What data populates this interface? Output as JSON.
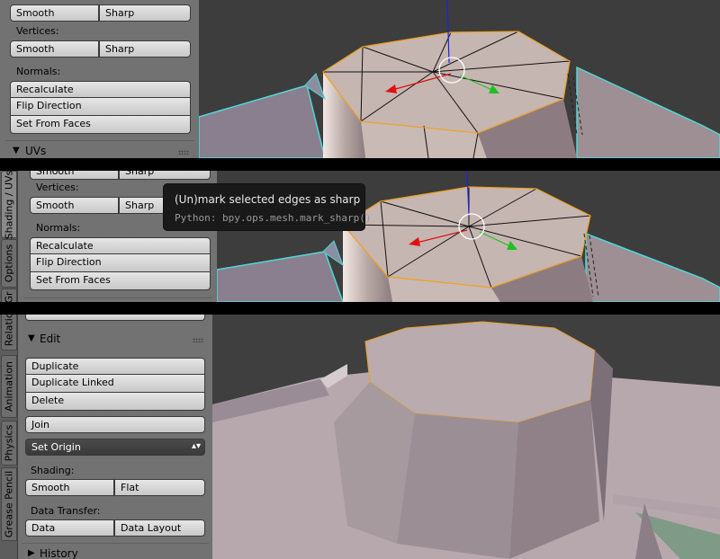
{
  "panel1": {
    "top_row": [
      "Smooth",
      "Sharp"
    ],
    "vertices_label": "Vertices:",
    "vertices_buttons": [
      "Smooth",
      "Sharp"
    ],
    "normals_label": "Normals:",
    "normals_buttons": [
      "Recalculate",
      "Flip Direction",
      "Set From Faces"
    ],
    "next_panel": "UVs",
    "next_panel_arrow": "▼"
  },
  "panel2": {
    "top_row": [
      "Smooth",
      "Sharp"
    ],
    "vertices_label": "Vertices:",
    "vertices_buttons": [
      "Smooth",
      "Sharp"
    ],
    "normals_label": "Normals:",
    "normals_buttons": [
      "Recalculate",
      "Flip Direction",
      "Set From Faces"
    ],
    "tabs": [
      "Shading / UVs",
      "Options",
      "Gr"
    ],
    "tooltip": {
      "title": "(Un)mark selected edges as sharp",
      "python": "Python: bpy.ops.mesh.mark_sharp()"
    }
  },
  "panel3": {
    "tabs": [
      "Relations",
      "Animation",
      "Physics",
      "Grease Pencil"
    ],
    "edit_header": "Edit",
    "edit_arrow": "▼",
    "edit_buttons": [
      "Duplicate",
      "Duplicate Linked",
      "Delete"
    ],
    "join_button": "Join",
    "set_origin": "Set Origin",
    "select_arrows": "▴▾",
    "shading_label": "Shading:",
    "shading_buttons": [
      "Smooth",
      "Flat"
    ],
    "data_transfer_label": "Data Transfer:",
    "data_transfer_buttons": [
      "Data",
      "Data Layout"
    ],
    "history_header": "History",
    "history_arrow": "▶"
  },
  "colors": {
    "viewport_bg": "#3d3d3d",
    "panel_bg": "#727272",
    "selection_orange": "#f0a020",
    "axis_red": "#e01010",
    "axis_green": "#20c020",
    "axis_blue": "#2020e0",
    "wire_cyan": "#50d8d8",
    "tooltip_bg": "#191919"
  }
}
